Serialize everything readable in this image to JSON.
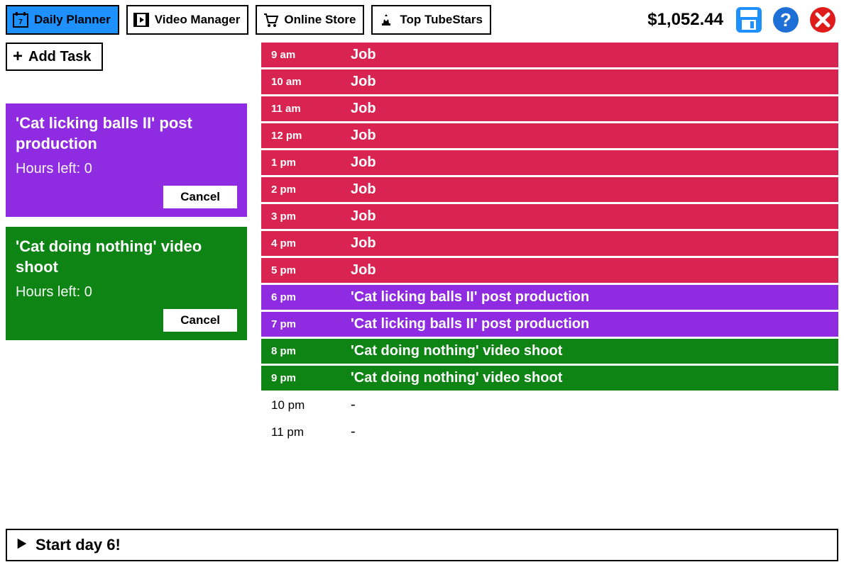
{
  "header": {
    "nav": [
      {
        "id": "daily-planner",
        "label": "Daily Planner",
        "active": true
      },
      {
        "id": "video-manager",
        "label": "Video Manager",
        "active": false
      },
      {
        "id": "online-store",
        "label": "Online Store",
        "active": false
      },
      {
        "id": "top-tubestars",
        "label": "Top TubeStars",
        "active": false
      }
    ],
    "balance": "$1,052.44"
  },
  "sidebar": {
    "add_task_label": "Add Task",
    "tasks": [
      {
        "id": "task-post-production",
        "title": "'Cat licking balls II' post production",
        "hours_left_label": "Hours left: 0",
        "cancel_label": "Cancel",
        "color": "purple"
      },
      {
        "id": "task-video-shoot",
        "title": "'Cat doing nothing' video shoot",
        "hours_left_label": "Hours left: 0",
        "cancel_label": "Cancel",
        "color": "green"
      }
    ]
  },
  "schedule": [
    {
      "time": "9 am",
      "label": "Job",
      "color": "red"
    },
    {
      "time": "10 am",
      "label": "Job",
      "color": "red"
    },
    {
      "time": "11 am",
      "label": "Job",
      "color": "red"
    },
    {
      "time": "12 pm",
      "label": "Job",
      "color": "red"
    },
    {
      "time": "1 pm",
      "label": "Job",
      "color": "red"
    },
    {
      "time": "2 pm",
      "label": "Job",
      "color": "red"
    },
    {
      "time": "3 pm",
      "label": "Job",
      "color": "red"
    },
    {
      "time": "4 pm",
      "label": "Job",
      "color": "red"
    },
    {
      "time": "5 pm",
      "label": "Job",
      "color": "red"
    },
    {
      "time": "6 pm",
      "label": "'Cat licking balls II' post production",
      "color": "purple"
    },
    {
      "time": "7 pm",
      "label": "'Cat licking balls II' post production",
      "color": "purple"
    },
    {
      "time": "8 pm",
      "label": "'Cat doing nothing' video shoot",
      "color": "green"
    },
    {
      "time": "9 pm",
      "label": "'Cat doing nothing' video shoot",
      "color": "green"
    },
    {
      "time": "10 pm",
      "label": "-",
      "color": "empty"
    },
    {
      "time": "11 pm",
      "label": "-",
      "color": "empty"
    }
  ],
  "footer": {
    "start_day_label": "Start day 6!"
  }
}
